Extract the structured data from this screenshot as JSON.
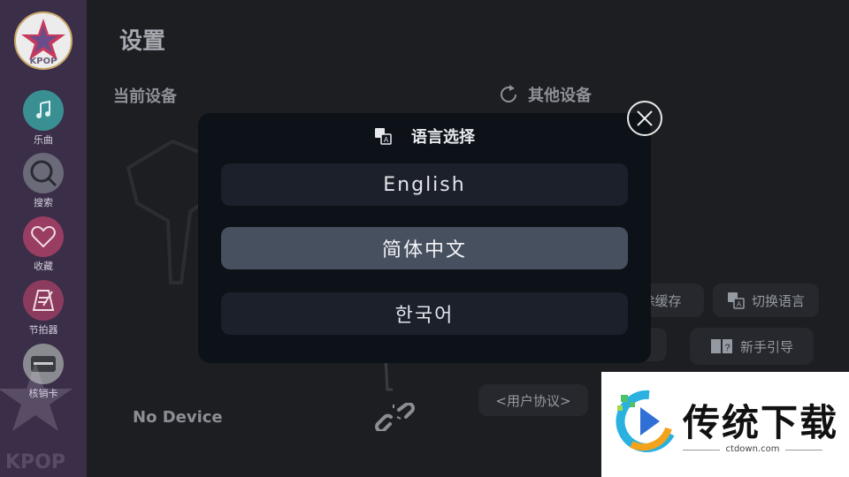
{
  "sidebar": {
    "logo_text": "KPOP",
    "bg_logo_text": "KPOP",
    "items": [
      {
        "label": "乐曲",
        "icon": "music-note-icon",
        "color": "#3a8f92"
      },
      {
        "label": "搜索",
        "icon": "search-icon",
        "color": "#6b6a78"
      },
      {
        "label": "收藏",
        "icon": "heart-icon",
        "color": "#9a3d63"
      },
      {
        "label": "节拍器",
        "icon": "metronome-icon",
        "color": "#8b3b5e"
      },
      {
        "label": "核销卡",
        "icon": "card-icon",
        "color": "#8a8b90"
      }
    ]
  },
  "page": {
    "title": "设置",
    "current_device_label": "当前设备",
    "other_devices_label": "其他设备",
    "clear_cache_label": "除缓存",
    "switch_language_label": "切换语言",
    "guide_label": "新手引导",
    "user_agreement_label": "<用户协议>",
    "no_device_label": "No Device"
  },
  "modal": {
    "title": "语言选择",
    "options": [
      {
        "label": "English",
        "selected": false
      },
      {
        "label": "简体中文",
        "selected": true
      },
      {
        "label": "한국어",
        "selected": false
      }
    ]
  },
  "watermark": {
    "title": "传统下载",
    "site": "ctdown.com"
  },
  "colors": {
    "modal_bg": "#0d1118",
    "option_bg": "#1b202a",
    "option_selected_bg": "#46505f",
    "sidebar_bg": "#3a2e48"
  }
}
